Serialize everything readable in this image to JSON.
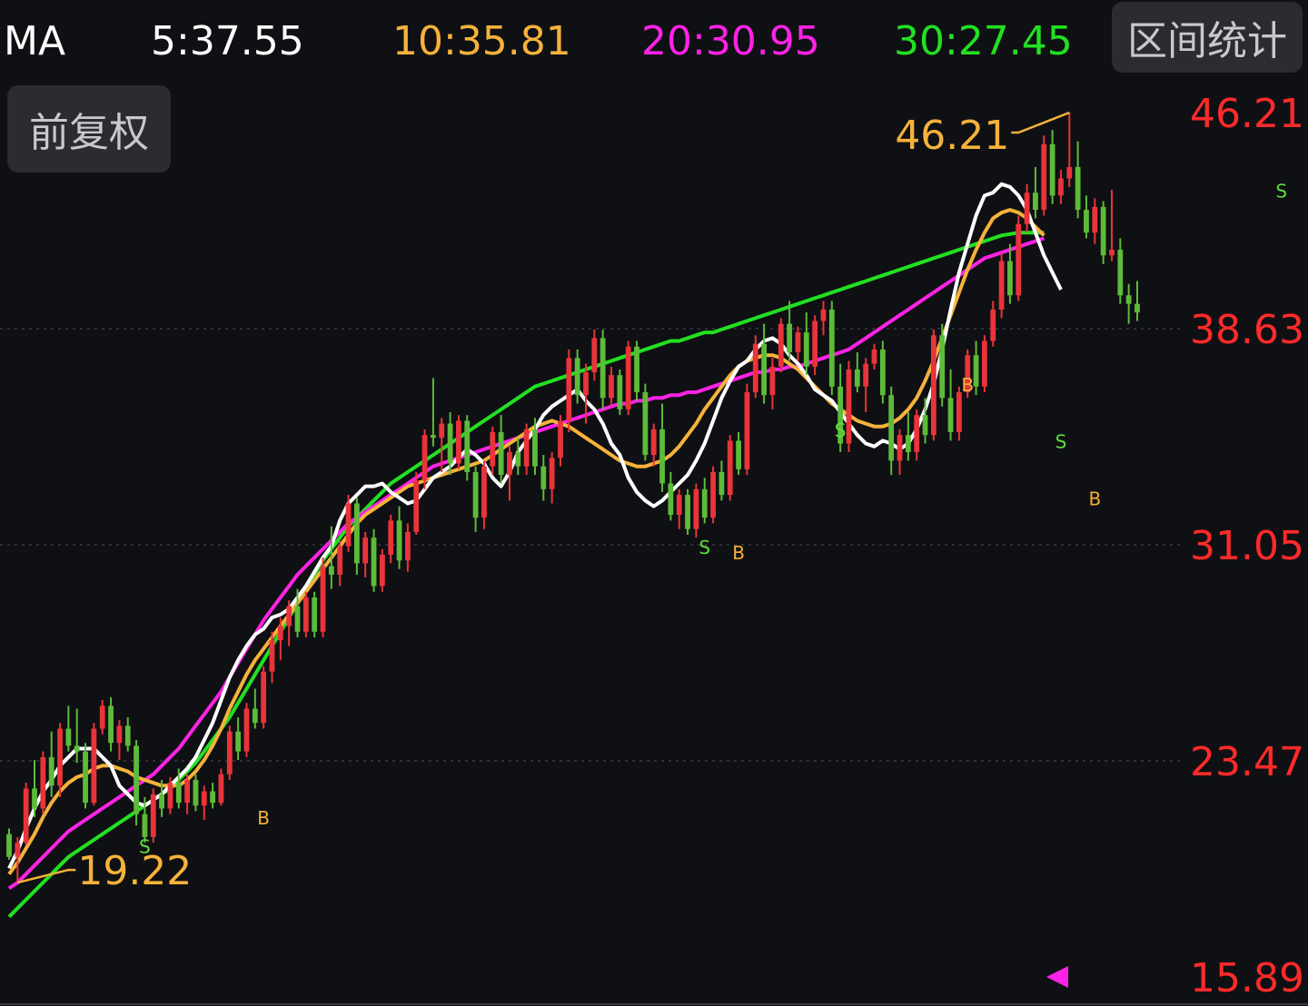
{
  "header": {
    "indicator": "MA",
    "ma5": "5:37.55",
    "ma10": "10:35.81",
    "ma20": "20:30.95",
    "ma30": "30:27.45",
    "range_stat_label": "区间统计",
    "adjust_label": "前复权"
  },
  "colors": {
    "background": "#0f1013",
    "up": "#e8343a",
    "down": "#5dbb3a",
    "ma5": "#ffffff",
    "ma10": "#f6b23b",
    "ma20": "#ff22e6",
    "ma30": "#22e022",
    "axis_label": "#ff2a2a"
  },
  "chart_data": {
    "type": "candlestick",
    "y_axis_labels": [
      "46.21",
      "38.63",
      "31.05",
      "23.47",
      "15.89"
    ],
    "ylim": [
      15.89,
      46.21
    ],
    "grid": "dotted horizontal",
    "high_annotation": "46.21",
    "low_annotation": "19.22",
    "series_names": [
      "MA5",
      "MA10",
      "MA20",
      "MA30"
    ],
    "candles": [
      [
        20.9,
        21.1,
        20.0,
        20.1
      ],
      [
        20.1,
        20.8,
        19.2,
        20.6
      ],
      [
        20.6,
        22.7,
        20.5,
        22.5
      ],
      [
        22.5,
        23.5,
        21.5,
        21.8
      ],
      [
        21.8,
        23.8,
        21.6,
        23.6
      ],
      [
        23.6,
        24.5,
        22.2,
        22.6
      ],
      [
        22.6,
        24.8,
        22.2,
        24.6
      ],
      [
        24.6,
        25.4,
        23.8,
        24.0
      ],
      [
        24.0,
        25.3,
        23.4,
        23.8
      ],
      [
        23.8,
        24.1,
        21.8,
        22.0
      ],
      [
        22.0,
        24.8,
        21.9,
        24.6
      ],
      [
        24.6,
        25.6,
        24.4,
        25.4
      ],
      [
        25.4,
        25.7,
        23.8,
        24.1
      ],
      [
        24.1,
        24.9,
        23.5,
        24.7
      ],
      [
        24.7,
        25.0,
        23.8,
        24.0
      ],
      [
        24.0,
        24.2,
        21.2,
        21.6
      ],
      [
        21.6,
        22.2,
        20.6,
        20.8
      ],
      [
        20.8,
        22.5,
        20.6,
        22.3
      ],
      [
        22.3,
        22.8,
        21.5,
        21.8
      ],
      [
        21.8,
        22.9,
        21.6,
        22.7
      ],
      [
        22.7,
        23.2,
        21.8,
        22.0
      ],
      [
        22.0,
        23.0,
        21.6,
        22.8
      ],
      [
        22.8,
        23.0,
        21.7,
        21.9
      ],
      [
        21.9,
        22.6,
        21.4,
        22.4
      ],
      [
        22.4,
        22.7,
        21.8,
        22.0
      ],
      [
        22.0,
        23.2,
        21.9,
        23.0
      ],
      [
        23.0,
        24.7,
        22.8,
        24.5
      ],
      [
        24.5,
        25.0,
        23.5,
        23.8
      ],
      [
        23.8,
        25.5,
        23.6,
        25.3
      ],
      [
        25.3,
        26.0,
        24.6,
        24.8
      ],
      [
        24.8,
        26.8,
        24.6,
        26.6
      ],
      [
        26.6,
        28.0,
        26.2,
        27.7
      ],
      [
        27.7,
        28.5,
        27.0,
        28.2
      ],
      [
        28.2,
        29.1,
        27.5,
        28.9
      ],
      [
        28.9,
        29.5,
        27.8,
        28.0
      ],
      [
        28.0,
        29.4,
        27.8,
        29.2
      ],
      [
        29.2,
        29.4,
        27.8,
        28.0
      ],
      [
        28.0,
        30.6,
        27.8,
        30.3
      ],
      [
        30.3,
        31.7,
        29.5,
        30.0
      ],
      [
        30.0,
        31.2,
        29.6,
        31.0
      ],
      [
        31.0,
        32.8,
        30.8,
        32.5
      ],
      [
        32.5,
        32.7,
        30.0,
        30.4
      ],
      [
        30.4,
        31.5,
        29.9,
        31.3
      ],
      [
        31.3,
        31.6,
        29.4,
        29.6
      ],
      [
        29.6,
        30.9,
        29.4,
        30.7
      ],
      [
        30.7,
        32.1,
        30.4,
        31.9
      ],
      [
        31.9,
        32.4,
        30.2,
        30.5
      ],
      [
        30.5,
        31.8,
        30.1,
        31.5
      ],
      [
        31.5,
        33.6,
        31.4,
        33.3
      ],
      [
        33.3,
        35.1,
        33.0,
        34.9
      ],
      [
        34.9,
        36.9,
        34.5,
        34.8
      ],
      [
        34.8,
        35.5,
        33.6,
        35.3
      ],
      [
        35.3,
        35.7,
        33.5,
        33.9
      ],
      [
        33.9,
        35.6,
        33.7,
        35.4
      ],
      [
        35.4,
        35.6,
        33.3,
        33.6
      ],
      [
        33.6,
        33.8,
        31.5,
        32.0
      ],
      [
        32.0,
        34.0,
        31.6,
        33.8
      ],
      [
        33.8,
        35.2,
        33.5,
        35.0
      ],
      [
        35.0,
        35.6,
        33.2,
        33.5
      ],
      [
        33.5,
        34.5,
        32.6,
        34.3
      ],
      [
        34.3,
        34.8,
        33.5,
        33.8
      ],
      [
        33.8,
        35.3,
        33.5,
        35.1
      ],
      [
        35.1,
        35.5,
        33.5,
        33.8
      ],
      [
        33.8,
        34.2,
        32.6,
        33.0
      ],
      [
        33.0,
        34.3,
        32.5,
        34.1
      ],
      [
        34.1,
        35.6,
        33.8,
        35.4
      ],
      [
        35.4,
        37.9,
        35.0,
        37.6
      ],
      [
        37.6,
        37.9,
        36.0,
        36.3
      ],
      [
        36.3,
        37.4,
        35.3,
        37.1
      ],
      [
        37.1,
        38.6,
        36.8,
        38.3
      ],
      [
        38.3,
        38.6,
        35.8,
        36.2
      ],
      [
        36.2,
        37.3,
        35.9,
        37.0
      ],
      [
        37.0,
        37.2,
        35.6,
        35.8
      ],
      [
        35.8,
        38.2,
        35.6,
        38.0
      ],
      [
        38.0,
        38.2,
        36.1,
        36.4
      ],
      [
        36.4,
        36.7,
        34.0,
        34.2
      ],
      [
        34.2,
        35.3,
        33.8,
        35.1
      ],
      [
        35.1,
        36.0,
        32.9,
        33.2
      ],
      [
        33.2,
        33.6,
        31.9,
        32.1
      ],
      [
        32.1,
        33.0,
        31.6,
        32.8
      ],
      [
        32.8,
        33.0,
        31.4,
        31.6
      ],
      [
        31.6,
        33.2,
        31.3,
        33.0
      ],
      [
        33.0,
        33.4,
        31.8,
        32.0
      ],
      [
        32.0,
        33.8,
        31.8,
        33.6
      ],
      [
        33.6,
        34.0,
        32.6,
        32.8
      ],
      [
        32.8,
        34.9,
        32.6,
        34.7
      ],
      [
        34.7,
        35.0,
        33.5,
        33.7
      ],
      [
        33.7,
        36.7,
        33.5,
        36.4
      ],
      [
        36.4,
        38.4,
        36.2,
        38.1
      ],
      [
        38.1,
        38.8,
        36.0,
        36.3
      ],
      [
        36.3,
        37.6,
        35.8,
        37.3
      ],
      [
        37.3,
        39.0,
        37.1,
        38.8
      ],
      [
        38.8,
        39.6,
        37.5,
        37.8
      ],
      [
        37.8,
        38.7,
        37.5,
        38.5
      ],
      [
        38.5,
        39.2,
        37.0,
        37.3
      ],
      [
        37.3,
        39.1,
        37.0,
        38.9
      ],
      [
        38.9,
        39.6,
        38.4,
        39.3
      ],
      [
        39.3,
        39.6,
        36.3,
        36.6
      ],
      [
        36.6,
        37.4,
        34.3,
        34.6
      ],
      [
        34.6,
        37.5,
        34.3,
        37.2
      ],
      [
        37.2,
        37.8,
        36.4,
        36.6
      ],
      [
        36.6,
        37.6,
        35.7,
        37.4
      ],
      [
        37.4,
        38.1,
        37.2,
        37.9
      ],
      [
        37.9,
        38.2,
        36.0,
        36.3
      ],
      [
        36.3,
        36.6,
        33.5,
        34.0
      ],
      [
        34.0,
        35.1,
        33.5,
        34.9
      ],
      [
        34.9,
        35.7,
        34.0,
        34.3
      ],
      [
        34.3,
        35.8,
        34.0,
        35.6
      ],
      [
        35.6,
        36.2,
        34.6,
        34.9
      ],
      [
        34.9,
        38.6,
        34.7,
        38.4
      ],
      [
        38.4,
        38.8,
        35.9,
        36.2
      ],
      [
        36.2,
        37.2,
        34.7,
        35.0
      ],
      [
        35.0,
        36.6,
        34.7,
        36.4
      ],
      [
        36.4,
        37.9,
        36.2,
        37.7
      ],
      [
        37.7,
        38.2,
        36.3,
        36.6
      ],
      [
        36.6,
        38.4,
        36.4,
        38.2
      ],
      [
        38.2,
        39.6,
        38.0,
        39.3
      ],
      [
        39.3,
        41.3,
        39.0,
        41.0
      ],
      [
        41.0,
        41.6,
        39.5,
        39.8
      ],
      [
        39.8,
        42.6,
        39.6,
        42.3
      ],
      [
        42.3,
        43.7,
        42.0,
        43.4
      ],
      [
        43.4,
        44.3,
        42.5,
        42.8
      ],
      [
        42.8,
        45.4,
        42.6,
        45.1
      ],
      [
        45.1,
        45.6,
        43.0,
        43.3
      ],
      [
        43.3,
        44.2,
        43.0,
        43.9
      ],
      [
        43.9,
        46.21,
        43.6,
        44.3
      ],
      [
        44.3,
        45.2,
        42.5,
        42.8
      ],
      [
        42.8,
        43.3,
        41.8,
        42.0
      ],
      [
        42.0,
        43.2,
        41.6,
        42.9
      ],
      [
        42.9,
        43.1,
        40.9,
        41.2
      ],
      [
        41.2,
        43.5,
        41.0,
        41.4
      ],
      [
        41.4,
        41.8,
        39.5,
        39.8
      ],
      [
        39.8,
        40.2,
        38.8,
        39.5
      ],
      [
        39.5,
        40.3,
        38.9,
        39.2
      ]
    ],
    "ma5": [
      19.7,
      20.3,
      21.1,
      21.8,
      22.4,
      22.8,
      23.3,
      23.6,
      23.9,
      23.9,
      23.9,
      23.6,
      23.3,
      22.6,
      22.3,
      22.0,
      21.9,
      22.1,
      22.3,
      22.6,
      22.9,
      23.2,
      23.6,
      24.2,
      24.8,
      25.6,
      26.4,
      27.0,
      27.5,
      27.9,
      28.1,
      28.5,
      28.6,
      28.8,
      29.2,
      29.6,
      30.1,
      30.6,
      31.0,
      31.9,
      32.5,
      32.8,
      33.1,
      33.1,
      33.2,
      32.9,
      32.7,
      32.5,
      32.6,
      33.0,
      33.4,
      33.6,
      33.8,
      34.1,
      34.4,
      34.2,
      33.9,
      33.4,
      33.1,
      33.6,
      34.3,
      34.7,
      35.1,
      35.6,
      35.9,
      36.1,
      36.3,
      36.5,
      36.1,
      35.8,
      35.3,
      34.6,
      34.2,
      33.4,
      32.9,
      32.6,
      32.4,
      32.6,
      32.9,
      33.2,
      33.5,
      34.0,
      34.6,
      35.4,
      36.2,
      36.8,
      37.3,
      37.5,
      37.9,
      38.2,
      38.3,
      38.1,
      37.7,
      37.4,
      37.0,
      36.5,
      36.3,
      36.1,
      35.7,
      35.3,
      34.9,
      34.6,
      34.5,
      34.7,
      34.6,
      34.4,
      34.6,
      35.1,
      35.8,
      36.7,
      37.9,
      39.3,
      40.6,
      41.6,
      42.6,
      43.3,
      43.4,
      43.7,
      43.6,
      43.3,
      42.8,
      42.0,
      41.2,
      40.6,
      40.0
    ],
    "ma10": [
      19.5,
      19.9,
      20.4,
      20.9,
      21.5,
      22.0,
      22.4,
      22.7,
      22.9,
      23.0,
      23.2,
      23.3,
      23.3,
      23.2,
      23.1,
      22.9,
      22.8,
      22.7,
      22.6,
      22.6,
      22.6,
      22.8,
      23.1,
      23.5,
      24.0,
      24.6,
      25.3,
      25.9,
      26.5,
      27.0,
      27.4,
      27.8,
      28.2,
      28.6,
      29.0,
      29.4,
      29.8,
      30.2,
      30.6,
      31.0,
      31.4,
      31.8,
      32.1,
      32.3,
      32.5,
      32.7,
      32.9,
      33.1,
      33.2,
      33.3,
      33.4,
      33.5,
      33.6,
      33.7,
      33.8,
      33.9,
      34.0,
      34.2,
      34.4,
      34.6,
      34.8,
      35.0,
      35.2,
      35.3,
      35.4,
      35.3,
      35.2,
      35.0,
      34.8,
      34.6,
      34.4,
      34.2,
      34.0,
      33.9,
      33.8,
      33.8,
      33.9,
      34.0,
      34.2,
      34.5,
      34.9,
      35.3,
      35.8,
      36.2,
      36.6,
      37.0,
      37.3,
      37.5,
      37.6,
      37.7,
      37.7,
      37.6,
      37.4,
      37.2,
      36.9,
      36.6,
      36.3,
      36.0,
      35.8,
      35.6,
      35.4,
      35.3,
      35.2,
      35.2,
      35.3,
      35.5,
      35.8,
      36.2,
      36.8,
      37.5,
      38.3,
      39.1,
      39.9,
      40.7,
      41.4,
      42.0,
      42.5,
      42.7,
      42.8,
      42.7,
      42.5,
      42.2,
      41.9
    ],
    "ma20": [
      19.0,
      19.2,
      19.5,
      19.8,
      20.1,
      20.4,
      20.7,
      21.0,
      21.2,
      21.4,
      21.6,
      21.8,
      22.0,
      22.2,
      22.4,
      22.6,
      22.8,
      23.0,
      23.3,
      23.6,
      23.9,
      24.3,
      24.7,
      25.1,
      25.5,
      25.9,
      26.4,
      26.9,
      27.4,
      27.9,
      28.4,
      28.8,
      29.2,
      29.6,
      30.0,
      30.3,
      30.6,
      30.9,
      31.2,
      31.5,
      31.8,
      32.0,
      32.2,
      32.4,
      32.6,
      32.8,
      33.0,
      33.2,
      33.4,
      33.6,
      33.8,
      33.9,
      34.0,
      34.1,
      34.2,
      34.3,
      34.4,
      34.5,
      34.6,
      34.7,
      34.8,
      34.9,
      35.0,
      35.1,
      35.2,
      35.3,
      35.4,
      35.5,
      35.6,
      35.7,
      35.8,
      35.9,
      36.0,
      36.0,
      36.1,
      36.1,
      36.2,
      36.2,
      36.3,
      36.3,
      36.4,
      36.4,
      36.5,
      36.6,
      36.7,
      36.8,
      36.9,
      37.0,
      37.1,
      37.1,
      37.2,
      37.2,
      37.3,
      37.3,
      37.4,
      37.5,
      37.6,
      37.7,
      37.8,
      37.9,
      38.1,
      38.3,
      38.5,
      38.7,
      38.9,
      39.1,
      39.3,
      39.5,
      39.7,
      39.9,
      40.1,
      40.3,
      40.5,
      40.7,
      40.9,
      41.1,
      41.2,
      41.3,
      41.4,
      41.5,
      41.6,
      41.7,
      41.8
    ],
    "ma30": [
      18.0,
      18.3,
      18.6,
      18.9,
      19.2,
      19.5,
      19.8,
      20.1,
      20.3,
      20.5,
      20.7,
      20.9,
      21.1,
      21.3,
      21.5,
      21.7,
      21.9,
      22.1,
      22.3,
      22.5,
      22.8,
      23.1,
      23.4,
      23.8,
      24.2,
      24.6,
      25.0,
      25.5,
      26.0,
      26.5,
      27.0,
      27.5,
      28.0,
      28.5,
      29.0,
      29.5,
      30.0,
      30.5,
      30.9,
      31.3,
      31.7,
      32.0,
      32.3,
      32.6,
      32.9,
      33.2,
      33.4,
      33.6,
      33.8,
      34.0,
      34.2,
      34.4,
      34.6,
      34.8,
      35.0,
      35.2,
      35.4,
      35.6,
      35.8,
      36.0,
      36.2,
      36.4,
      36.6,
      36.7,
      36.8,
      36.9,
      37.0,
      37.1,
      37.2,
      37.3,
      37.4,
      37.5,
      37.6,
      37.7,
      37.8,
      37.9,
      38.0,
      38.1,
      38.2,
      38.2,
      38.3,
      38.4,
      38.5,
      38.5,
      38.6,
      38.7,
      38.8,
      38.9,
      39.0,
      39.1,
      39.2,
      39.3,
      39.4,
      39.5,
      39.6,
      39.7,
      39.8,
      39.9,
      40.0,
      40.1,
      40.2,
      40.3,
      40.4,
      40.5,
      40.6,
      40.7,
      40.8,
      40.9,
      41.0,
      41.1,
      41.2,
      41.3,
      41.4,
      41.5,
      41.6,
      41.7,
      41.8,
      41.9,
      41.95,
      42.0,
      42.0,
      42.0,
      42.0
    ],
    "signals": [
      {
        "label": "S",
        "index": 16,
        "price": 21.0,
        "kind": "sell"
      },
      {
        "label": "B",
        "index": 30,
        "price": 22.0,
        "kind": "buy"
      },
      {
        "label": "S",
        "index": 82,
        "price": 31.5,
        "kind": "sell"
      },
      {
        "label": "B",
        "index": 86,
        "price": 31.3,
        "kind": "buy"
      },
      {
        "label": "S",
        "index": 98,
        "price": 35.6,
        "kind": "sell"
      },
      {
        "label": "B",
        "index": 113,
        "price": 37.2,
        "kind": "buy"
      },
      {
        "label": "S",
        "index": 124,
        "price": 35.2,
        "kind": "sell"
      },
      {
        "label": "B",
        "index": 128,
        "price": 33.2,
        "kind": "buy"
      },
      {
        "label": "S",
        "index": 150,
        "price": 44.0,
        "kind": "sell"
      }
    ]
  }
}
